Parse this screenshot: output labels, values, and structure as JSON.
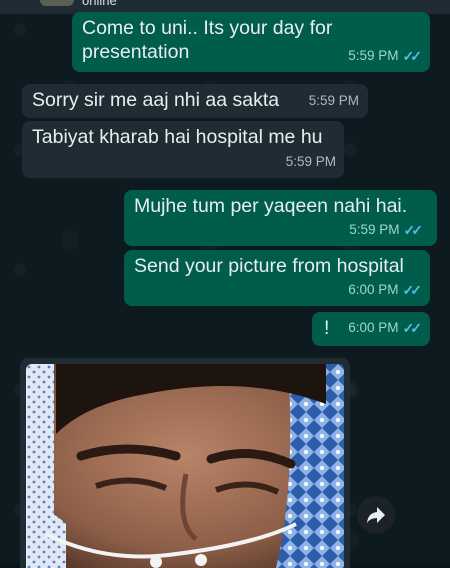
{
  "header": {
    "status": "online"
  },
  "messages": [
    {
      "direction": "outgoing",
      "text_line1": "Come to uni.. Its your day for",
      "text_line2": "presentation",
      "time": "5:59 PM",
      "read": true
    },
    {
      "direction": "incoming",
      "text": "Sorry sir me aaj nhi aa sakta",
      "time": "5:59 PM"
    },
    {
      "direction": "incoming",
      "text": "Tabiyat kharab hai hospital me hu",
      "time": "5:59 PM"
    },
    {
      "direction": "outgoing",
      "text": "Mujhe tum per yaqeen nahi hai.",
      "time": "5:59 PM",
      "read": true
    },
    {
      "direction": "outgoing",
      "text": "Send your picture from hospital",
      "time": "6:00 PM",
      "read": true
    },
    {
      "direction": "outgoing",
      "text": "!",
      "time": "6:00 PM",
      "read": true
    }
  ],
  "photo_message": {
    "direction": "incoming",
    "content": "photo",
    "action_icon": "forward-arrow-icon"
  },
  "colors": {
    "outgoing_bubble": "#005c4b",
    "incoming_bubble": "#202c33",
    "read_ticks": "#53bdeb",
    "background": "#0d1a1f"
  },
  "icons": {
    "read_receipt": "double-check-icon"
  }
}
